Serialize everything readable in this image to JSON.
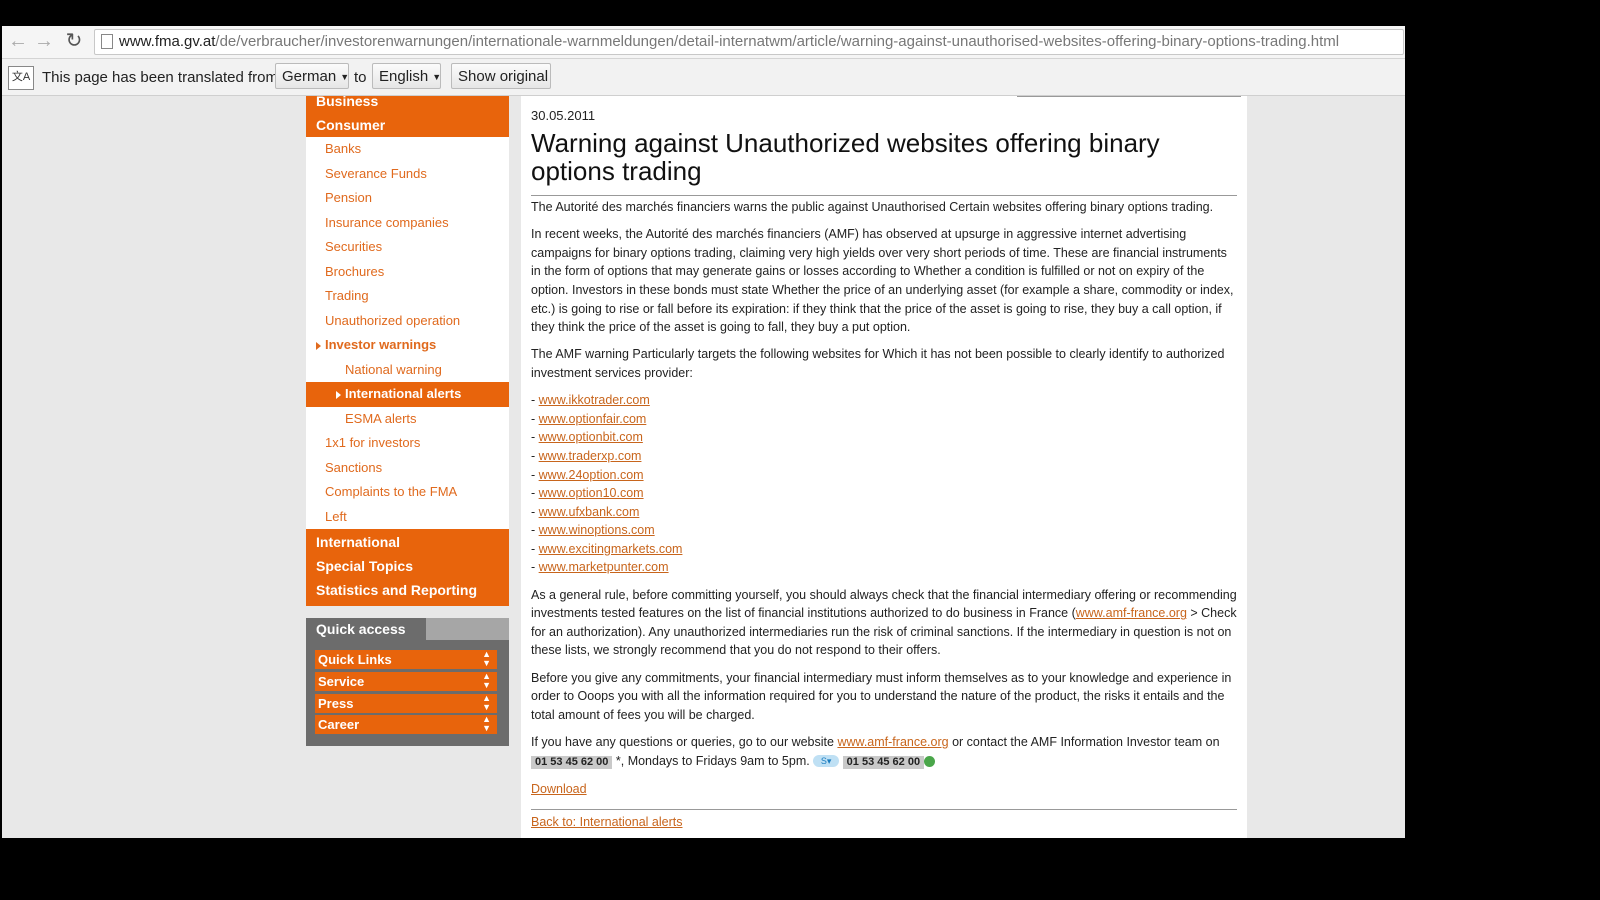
{
  "browser": {
    "url_host": "www.fma.gv.at",
    "url_path": "/de/verbraucher/investorenwarnungen/internationale-warnmeldungen/detail-internatwm/article/warning-against-unauthorised-websites-offering-binary-options-trading.html"
  },
  "translate_bar": {
    "prefix": "This page has been translated from",
    "from_lang": "German",
    "to_text": "to",
    "to_lang": "English",
    "show_original": "Show original"
  },
  "nav": {
    "business": "Business",
    "consumer": "Consumer",
    "consumer_items": [
      "Banks",
      "Severance Funds",
      "Pension",
      "Insurance companies",
      "Securities",
      "Brochures",
      "Trading",
      "Unauthorized operation"
    ],
    "investor_warnings": "Investor warnings",
    "iw_items": [
      "National warning",
      "International alerts",
      "ESMA alerts"
    ],
    "after_items": [
      "1x1 for investors",
      "Sanctions",
      "Complaints to the FMA",
      "Left"
    ],
    "bottom_items": [
      "International",
      "Special Topics",
      "Statistics and Reporting"
    ]
  },
  "quick_access": {
    "title": "Quick access",
    "items": [
      "Quick Links",
      "Service",
      "Press",
      "Career"
    ]
  },
  "article": {
    "date": "30.05.2011",
    "title": "Warning against Unauthorized websites offering binary options trading",
    "intro": "The Autorité des marchés financiers warns the public against Unauthorised Certain websites offering binary options trading.",
    "para1": "In recent weeks, the Autorité des marchés financiers (AMF) has observed at upsurge in aggressive internet advertising campaigns for binary options trading, claiming very high yields over very short periods of time. These are financial instruments in the form of options that may generate gains or losses according to Whether a condition is fulfilled or not on expiry of the option. Investors in these bonds must state Whether the price of an underlying asset (for example a share, commodity or index, etc.) is going to rise or fall before its expiration: if they think that the price of the asset is going to rise, they buy a call option, if they think the price of the asset is going to fall, they buy a put option.",
    "para2": "The AMF warning Particularly targets the following websites for Which it has not been possible to clearly identify to authorized investment services provider:",
    "sites": [
      "www.ikkotrader.com",
      "www.optionfair.com",
      "www.optionbit.com",
      "www.traderxp.com",
      "www.24option.com",
      "www.option10.com",
      "www.ufxbank.com",
      "www.winoptions.com",
      "www.excitingmarkets.com",
      "www.marketpunter.com"
    ],
    "para3_a": "As a general rule, before committing yourself, you should always check that the financial intermediary offering or recommending investments tested features on the list of financial institutions authorized to do business in France (",
    "para3_link": "www.amf-france.org",
    "para3_b": " > Check for an authorization). Any unauthorized intermediaries run the risk of criminal sanctions. If the intermediary in question is not on these lists, we strongly recommend that you do not respond to their offers.",
    "para4": "Before you give any commitments, your financial intermediary must inform themselves as to your knowledge and experience in order to Ooops you with all the information required for you to understand the nature of the product, the risks it entails and the total amount of fees you will be charged.",
    "para5_a": "If you have any questions or queries, go to our website ",
    "para5_link": "www.amf-france.org",
    "para5_b": " or contact the AMF Information Investor team on",
    "phone1": "01 53 45 62 00",
    "para5_c": " *, Mondays to Fridays 9am to 5pm. ",
    "phone2": "01 53 45 62 00",
    "download": "Download",
    "back": "Back to: International alerts"
  },
  "colors": {
    "accent": "#e8640c",
    "link": "#c8651c",
    "quick_bg": "#6c6c6c"
  }
}
